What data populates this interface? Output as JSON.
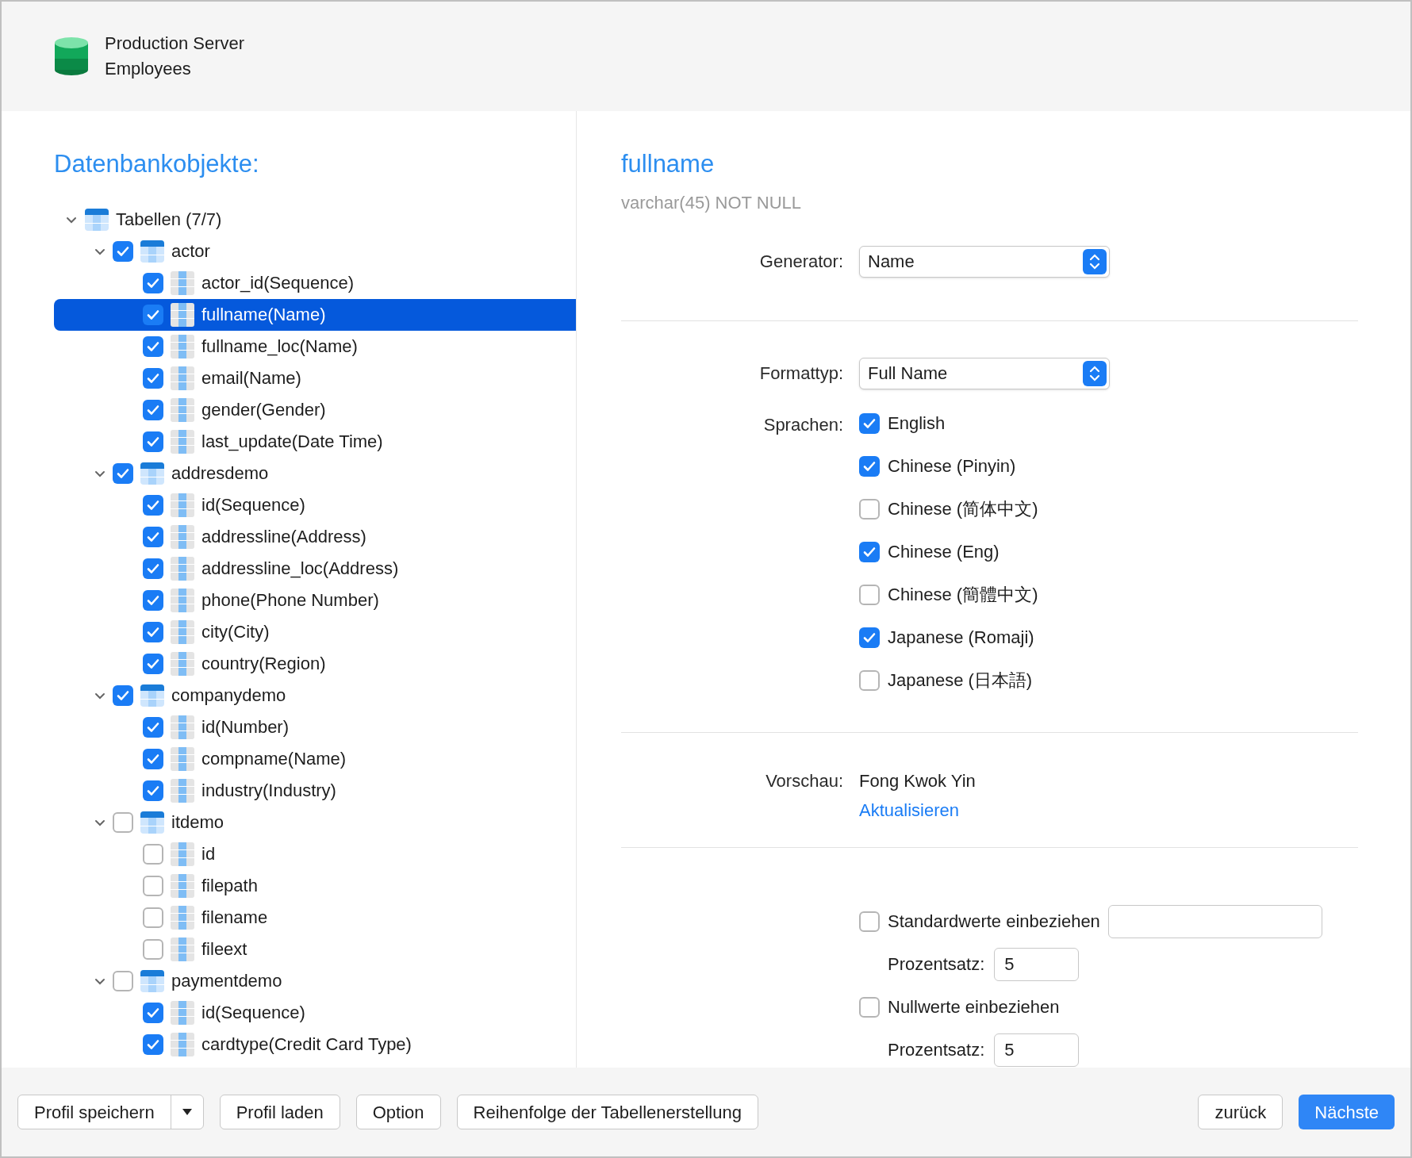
{
  "header": {
    "server": "Production Server",
    "database": "Employees"
  },
  "tree": {
    "title": "Datenbankobjekte:",
    "root": {
      "label": "Tabellen (7/7)",
      "expanded": true,
      "children": [
        {
          "label": "actor",
          "checked": true,
          "expanded": true,
          "selected": false,
          "children": [
            {
              "label": "actor_id(Sequence)",
              "checked": true,
              "selected": false
            },
            {
              "label": "fullname(Name)",
              "checked": true,
              "selected": true
            },
            {
              "label": "fullname_loc(Name)",
              "checked": true,
              "selected": false
            },
            {
              "label": "email(Name)",
              "checked": true,
              "selected": false
            },
            {
              "label": "gender(Gender)",
              "checked": true,
              "selected": false
            },
            {
              "label": "last_update(Date Time)",
              "checked": true,
              "selected": false
            }
          ]
        },
        {
          "label": "addresdemo",
          "checked": true,
          "expanded": true,
          "selected": false,
          "children": [
            {
              "label": "id(Sequence)",
              "checked": true,
              "selected": false
            },
            {
              "label": "addressline(Address)",
              "checked": true,
              "selected": false
            },
            {
              "label": "addressline_loc(Address)",
              "checked": true,
              "selected": false
            },
            {
              "label": "phone(Phone Number)",
              "checked": true,
              "selected": false
            },
            {
              "label": "city(City)",
              "checked": true,
              "selected": false
            },
            {
              "label": "country(Region)",
              "checked": true,
              "selected": false
            }
          ]
        },
        {
          "label": "companydemo",
          "checked": true,
          "expanded": true,
          "selected": false,
          "children": [
            {
              "label": "id(Number)",
              "checked": true,
              "selected": false
            },
            {
              "label": "compname(Name)",
              "checked": true,
              "selected": false
            },
            {
              "label": "industry(Industry)",
              "checked": true,
              "selected": false
            }
          ]
        },
        {
          "label": "itdemo",
          "checked": false,
          "expanded": true,
          "selected": false,
          "children": [
            {
              "label": "id",
              "checked": false,
              "selected": false
            },
            {
              "label": "filepath",
              "checked": false,
              "selected": false
            },
            {
              "label": "filename",
              "checked": false,
              "selected": false
            },
            {
              "label": "fileext",
              "checked": false,
              "selected": false
            }
          ]
        },
        {
          "label": "paymentdemo",
          "checked": false,
          "expanded": true,
          "selected": false,
          "children": [
            {
              "label": "id(Sequence)",
              "checked": true,
              "selected": false
            },
            {
              "label": "cardtype(Credit Card Type)",
              "checked": true,
              "selected": false
            }
          ]
        }
      ]
    }
  },
  "detail": {
    "title": "fullname",
    "type": "varchar(45) NOT NULL",
    "generator": {
      "label": "Generator:",
      "value": "Name"
    },
    "format": {
      "label": "Formattyp:",
      "value": "Full Name"
    },
    "languages": {
      "label": "Sprachen:",
      "items": [
        {
          "label": "English",
          "checked": true
        },
        {
          "label": "Chinese (Pinyin)",
          "checked": true
        },
        {
          "label": "Chinese (简体中文)",
          "checked": false
        },
        {
          "label": "Chinese (Eng)",
          "checked": true
        },
        {
          "label": "Chinese (簡體中文)",
          "checked": false
        },
        {
          "label": "Japanese (Romaji)",
          "checked": true
        },
        {
          "label": "Japanese (日本語)",
          "checked": false
        }
      ]
    },
    "preview": {
      "label": "Vorschau:",
      "value": "Fong Kwok Yin",
      "link": "Aktualisieren"
    },
    "defaults": {
      "label": "Standardwerte einbeziehen",
      "checked": false,
      "percent_label": "Prozentsatz:",
      "percent": "5"
    },
    "nulls": {
      "label": "Nullwerte einbeziehen",
      "checked": false,
      "percent_label": "Prozentsatz:",
      "percent": "5"
    }
  },
  "footer": {
    "save": "Profil speichern",
    "load": "Profil laden",
    "option": "Option",
    "order": "Reihenfolge der Tabellenerstellung",
    "back": "zurück",
    "next": "Nächste"
  }
}
